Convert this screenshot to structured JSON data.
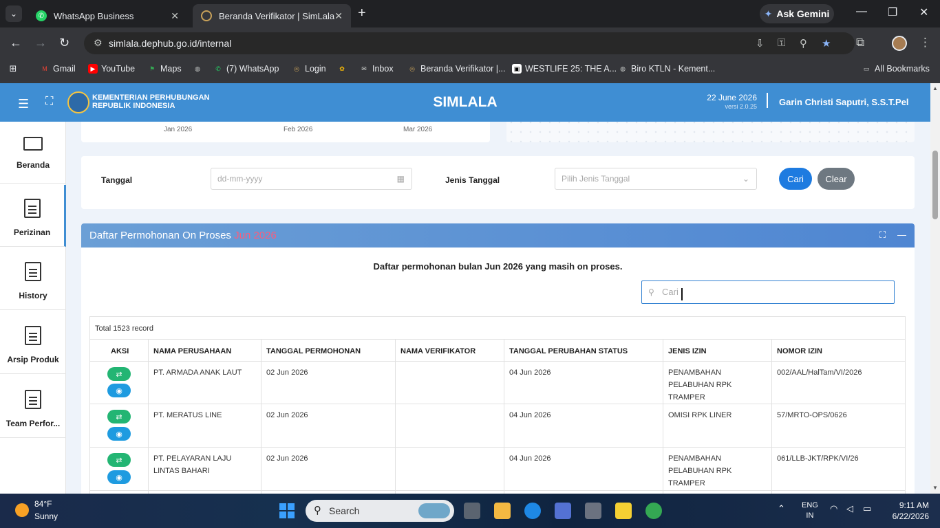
{
  "browser": {
    "tabs": [
      {
        "title": "WhatsApp Business",
        "active": false
      },
      {
        "title": "Beranda Verifikator | SimLala",
        "active": true
      }
    ],
    "gemini_label": "Ask Gemini",
    "url": "simlala.dephub.go.id/internal",
    "bookmarks": [
      "Gmail",
      "YouTube",
      "Maps",
      "(7) WhatsApp",
      "Login",
      "Inbox",
      "Beranda Verifikator |...",
      "WESTLIFE 25: THE A...",
      "Biro KTLN - Kement..."
    ],
    "all_bookmarks": "All Bookmarks"
  },
  "header": {
    "org_line1": "KEMENTERIAN PERHUBUNGAN",
    "org_line2": "REPUBLIK INDONESIA",
    "title": "SIMLALA",
    "date": "22 June 2026",
    "version": "versi 2.0.25",
    "user": "Garin Christi Saputri, S.S.T.Pel"
  },
  "sidebar": {
    "items": [
      {
        "label": "Beranda"
      },
      {
        "label": "Perizinan"
      },
      {
        "label": "History"
      },
      {
        "label": "Arsip Produk"
      },
      {
        "label": "Team Perfor..."
      }
    ]
  },
  "chart": {
    "x_labels": [
      "Jan 2026",
      "Feb 2026",
      "Mar 2026"
    ]
  },
  "filter": {
    "tanggal_label": "Tanggal",
    "tanggal_placeholder": "dd-mm-yyyy",
    "jenis_label": "Jenis Tanggal",
    "jenis_placeholder": "Pilih Jenis Tanggal",
    "cari": "Cari",
    "clear": "Clear"
  },
  "list": {
    "title": "Daftar Permohonan On Proses",
    "title_highlight": "Jun 2026",
    "subtitle": "Daftar permohonan bulan Jun 2026 yang masih on proses.",
    "search_placeholder": "Cari",
    "total": "Total 1523 record",
    "columns": [
      "AKSI",
      "NAMA PERUSAHAAN",
      "TANGGAL PERMOHONAN",
      "NAMA VERIFIKATOR",
      "TANGGAL PERUBAHAN STATUS",
      "JENIS IZIN",
      "NOMOR IZIN"
    ],
    "rows": [
      {
        "nama": "PT. ARMADA ANAK LAUT",
        "tgl_permohonan": "02 Jun 2026",
        "verifikator": "",
        "tgl_status": "04 Jun 2026",
        "jenis": "PENAMBAHAN PELABUHAN RPK TRAMPER",
        "nomor": "002/AAL/HalTam/VI/2026"
      },
      {
        "nama": "PT. MERATUS LINE",
        "tgl_permohonan": "02 Jun 2026",
        "verifikator": "",
        "tgl_status": "04 Jun 2026",
        "jenis": "OMISI RPK LINER",
        "nomor": "57/MRTO-OPS/0626"
      },
      {
        "nama": "PT. PELAYARAN LAJU LINTAS BAHARI",
        "tgl_permohonan": "02 Jun 2026",
        "verifikator": "",
        "tgl_status": "04 Jun 2026",
        "jenis": "PENAMBAHAN PELABUHAN RPK TRAMPER",
        "nomor": "061/LLB-JKT/RPK/VI/26"
      }
    ]
  },
  "taskbar": {
    "temp": "84°F",
    "condition": "Sunny",
    "search": "Search",
    "lang1": "ENG",
    "lang2": "IN",
    "time": "9:11 AM",
    "date": "6/22/2026"
  }
}
